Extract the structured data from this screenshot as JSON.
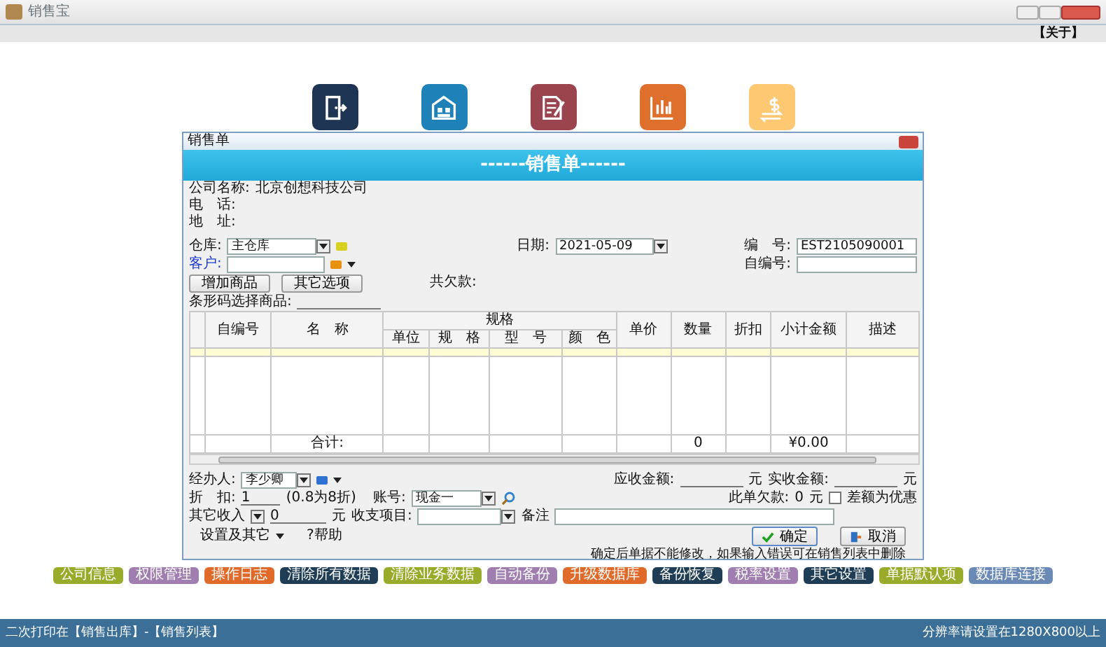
{
  "window": {
    "title": "销售宝",
    "about": "【关于】"
  },
  "nav_icons": [
    {
      "kind": "exit",
      "color": "#1d3553"
    },
    {
      "kind": "warehouse",
      "color": "#1e82b8"
    },
    {
      "kind": "document",
      "color": "#9a4450"
    },
    {
      "kind": "chart",
      "color": "#de6f2c"
    },
    {
      "kind": "money",
      "color": "#fec771"
    }
  ],
  "dialog": {
    "title": "销售单",
    "banner": "------销售单------",
    "company": [
      {
        "label": "公司名称:",
        "value": "北京创想科技公司"
      },
      {
        "label": "电　话:"
      },
      {
        "label": "地　址:"
      }
    ],
    "warehouse": {
      "label": "仓库:",
      "value": "主仓库"
    },
    "customer": {
      "label": "客户:"
    },
    "date": {
      "label": "日期:",
      "value": "2021-05-09"
    },
    "number": {
      "label": "编　号:",
      "value": "EST2105090001"
    },
    "custom_number": {
      "label": "自编号:"
    },
    "buttons": [
      "增加商品",
      "其它选项"
    ],
    "debt_label": "共欠款:",
    "barcode_label": "条形码选择商品:",
    "table": {
      "group_label": "规格",
      "columns": [
        {
          "label": "自编号",
          "kind": "main"
        },
        {
          "label": "名　称",
          "kind": "main"
        },
        {
          "label": "单位",
          "kind": "sub"
        },
        {
          "label": "规　格",
          "kind": "sub"
        },
        {
          "label": "型　号",
          "kind": "sub"
        },
        {
          "label": "颜　色",
          "kind": "sub"
        },
        {
          "label": "单价",
          "kind": "main"
        },
        {
          "label": "数量",
          "kind": "main"
        },
        {
          "label": "折扣",
          "kind": "main"
        },
        {
          "label": "小计金额",
          "kind": "main"
        },
        {
          "label": "描述",
          "kind": "main"
        }
      ],
      "totals": {
        "label": "合计:",
        "quantity": "0",
        "amount": "¥0.00"
      }
    },
    "handler": {
      "label": "经办人:",
      "value": "李少卿"
    },
    "discount": {
      "label": "折　扣:",
      "value": "1",
      "hint": "(0.8为8折)"
    },
    "account": {
      "label": "账号:",
      "value": "现金一"
    },
    "receivable": {
      "label": "应收金额:",
      "unit": "元"
    },
    "received": {
      "label": "实收金额:",
      "unit": "元"
    },
    "owed": {
      "label": "此单欠款:",
      "value": "0",
      "unit": "元"
    },
    "difference": {
      "label": "差额为优惠",
      "checked": false
    },
    "other_income": {
      "label": "其它收入",
      "value": "0",
      "unit": "元"
    },
    "category": {
      "label": "收支项目:"
    },
    "remark": {
      "label": "备注"
    },
    "settings": "设置及其它",
    "help": "?帮助",
    "ok": "确定",
    "cancel": "取消",
    "note": "确定后单据不能修改，如果输入错误可在销售列表中删除"
  },
  "function_buttons": [
    {
      "label": "公司信息",
      "color": "#9aaa2a"
    },
    {
      "label": "权限管理",
      "color": "#a07fb0"
    },
    {
      "label": "操作日志",
      "color": "#e06a2a"
    },
    {
      "label": "清除所有数据",
      "color": "#1f3d55"
    },
    {
      "label": "清除业务数据",
      "color": "#9aaa2a"
    },
    {
      "label": "自动备份",
      "color": "#a07fb0"
    },
    {
      "label": "升级数据库",
      "color": "#e06a2a"
    },
    {
      "label": "备份恢复",
      "color": "#1f3d55"
    },
    {
      "label": "税率设置",
      "color": "#a07fb0"
    },
    {
      "label": "其它设置",
      "color": "#1f3d55"
    },
    {
      "label": "单据默认项",
      "color": "#9aaa2a"
    },
    {
      "label": "数据库连接",
      "color": "#6a8ab5"
    }
  ],
  "status_bar": {
    "left": "二次打印在【销售出库】-【销售列表】",
    "right": "分辨率请设置在1280X800以上"
  }
}
